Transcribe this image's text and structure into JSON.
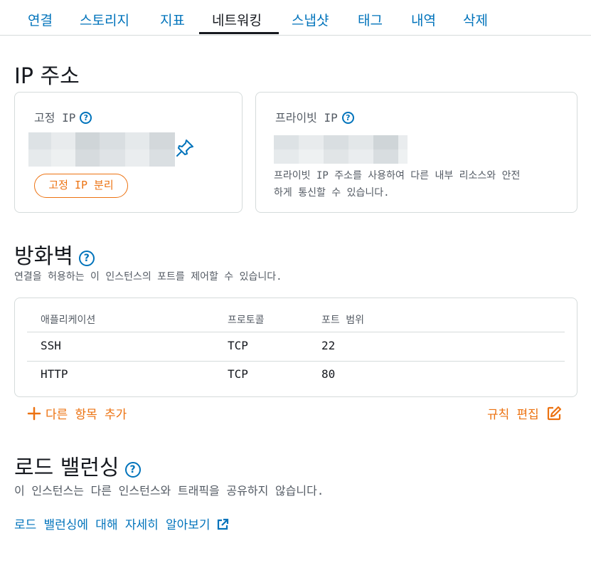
{
  "tabs": [
    {
      "label": "연결"
    },
    {
      "label": "스토리지"
    },
    {
      "label": "지표"
    },
    {
      "label": "네트워킹"
    },
    {
      "label": "스냅샷"
    },
    {
      "label": "태그"
    },
    {
      "label": "내역"
    },
    {
      "label": "삭제"
    }
  ],
  "active_tab": "네트워킹",
  "ip": {
    "heading": "IP 주소",
    "static": {
      "title": "고정 IP",
      "detach_label": "고정 IP 분리",
      "pin_icon": "pin-icon"
    },
    "private": {
      "title": "프라이빗 IP",
      "description_line1": "프라이빗 IP 주소를 사용하여 다른 내부 리소스와 안전",
      "description_line2": "하게 통신할 수 있습니다."
    }
  },
  "firewall": {
    "heading": "방화벽",
    "description": "연결을 허용하는 이 인스턴스의 포트를 제어할 수 있습니다.",
    "columns": [
      "애플리케이션",
      "프로토콜",
      "포트 범위"
    ],
    "rows": [
      {
        "application": "SSH",
        "protocol": "TCP",
        "port": "22"
      },
      {
        "application": "HTTP",
        "protocol": "TCP",
        "port": "80"
      }
    ],
    "add_label": "다른 항목 추가",
    "edit_label": "규칙 편집"
  },
  "load_balancing": {
    "heading": "로드 밸런싱",
    "description": "이 인스턴스는 다른 인스턴스와 트래픽을 공유하지 않습니다.",
    "learn_more_label": "로드 밸런싱에 대해 자세히 알아보기"
  },
  "colors": {
    "link": "#0073bb",
    "accent": "#ec7211",
    "text": "#16191f",
    "muted": "#545b64",
    "border": "#d5dbdb"
  }
}
